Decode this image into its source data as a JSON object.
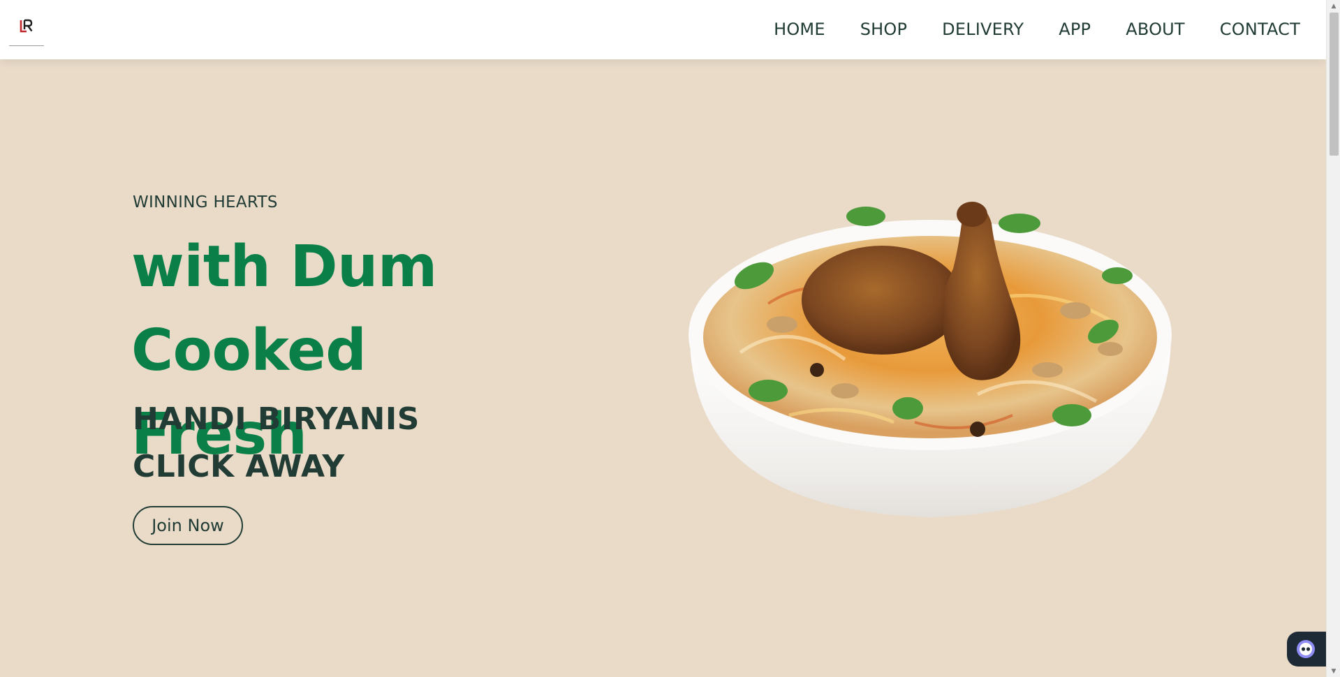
{
  "header": {
    "logo_icon": "lr-logo-icon",
    "nav": [
      "HOME",
      "SHOP",
      "DELIVERY",
      "APP",
      "ABOUT",
      "CONTACT"
    ]
  },
  "hero": {
    "eyebrow": "WINNING HEARTS",
    "headline_line1": "with Dum Cooked",
    "headline_line2": "Fresh",
    "subline_line1": "HANDI BIRYANIS",
    "subline_line2": "CLICK AWAY",
    "cta_label": "Join Now",
    "image_icon": "biryani-bowl-image"
  },
  "colors": {
    "hero_bg": "#eadbc9",
    "headline": "#0a8048",
    "text_dark": "#213b35",
    "logo_red": "#c0282d"
  },
  "widget": {
    "icon": "chat-bot-icon"
  }
}
